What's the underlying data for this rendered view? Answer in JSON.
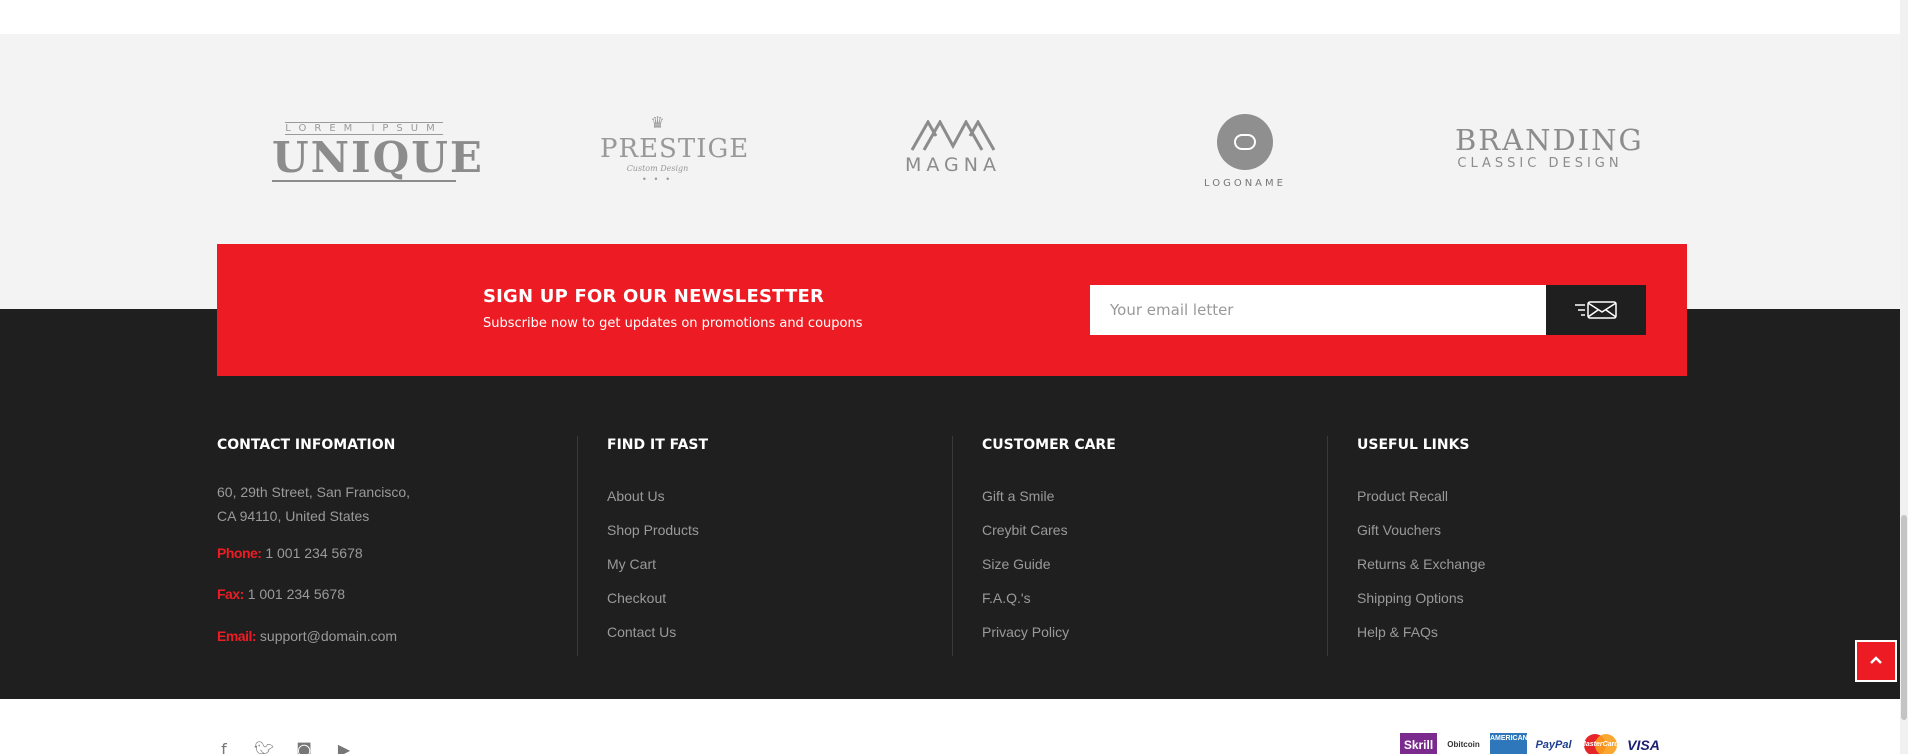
{
  "brands": {
    "unique": {
      "small": "LOREM IPSUM",
      "big": "UNIQUE"
    },
    "prestige": {
      "crown": "♛",
      "big": "PRESTIGE",
      "small": "Custom Design",
      "dots": "• • •"
    },
    "magna": {
      "big": "MAGNA"
    },
    "logoname": {
      "small": "LOGONAME"
    },
    "branding": {
      "big": "BRANDING",
      "small": "CLASSIC DESIGN"
    }
  },
  "newsletter": {
    "title": "SIGN UP FOR OUR NEWSLESTTER",
    "subtitle": "Subscribe now to get updates on promotions and coupons",
    "email_placeholder": "Your email letter",
    "submit_icon": "send-mail-icon",
    "background_color": "#ed1c24"
  },
  "footer": {
    "contact": {
      "title": "CONTACT INFOMATION",
      "address_line1": "60, 29th Street, San Francisco,",
      "address_line2": "CA 94110, United States",
      "phone_label": "Phone:",
      "phone": "1 001 234 5678",
      "fax_label": "Fax:",
      "fax": "1 001 234 5678",
      "email_label": "Email:",
      "email": "support@domain.com"
    },
    "find_it_fast": {
      "title": "FIND IT FAST",
      "links": [
        "About Us",
        "Shop Products",
        "My Cart",
        "Checkout",
        "Contact Us"
      ]
    },
    "customer_care": {
      "title": "CUSTOMER CARE",
      "links": [
        "Gift a Smile",
        "Creybit Cares",
        "Size Guide",
        "F.A.Q.'s",
        "Privacy Policy"
      ]
    },
    "useful_links": {
      "title": "USEFUL LINKS",
      "links": [
        "Product Recall",
        "Gift Vouchers",
        "Returns & Exchange",
        "Shipping Options",
        "Help & FAQs"
      ]
    }
  },
  "back_to_top_icon": "chevron-up-icon",
  "social_icons": [
    "facebook-icon",
    "twitter-icon",
    "instagram-icon",
    "youtube-icon"
  ],
  "payments": {
    "skrill": "Skrill",
    "bitcoin": "Obitcoin",
    "amex": "AMERICAN EXPRESS",
    "paypal": "PayPal",
    "mastercard": "MasterCard",
    "visa": "VISA"
  },
  "colors": {
    "accent": "#ed1c24",
    "dark": "#1f1f1f",
    "light_band": "#f3f3f3",
    "muted_text": "#9a9a9a"
  }
}
